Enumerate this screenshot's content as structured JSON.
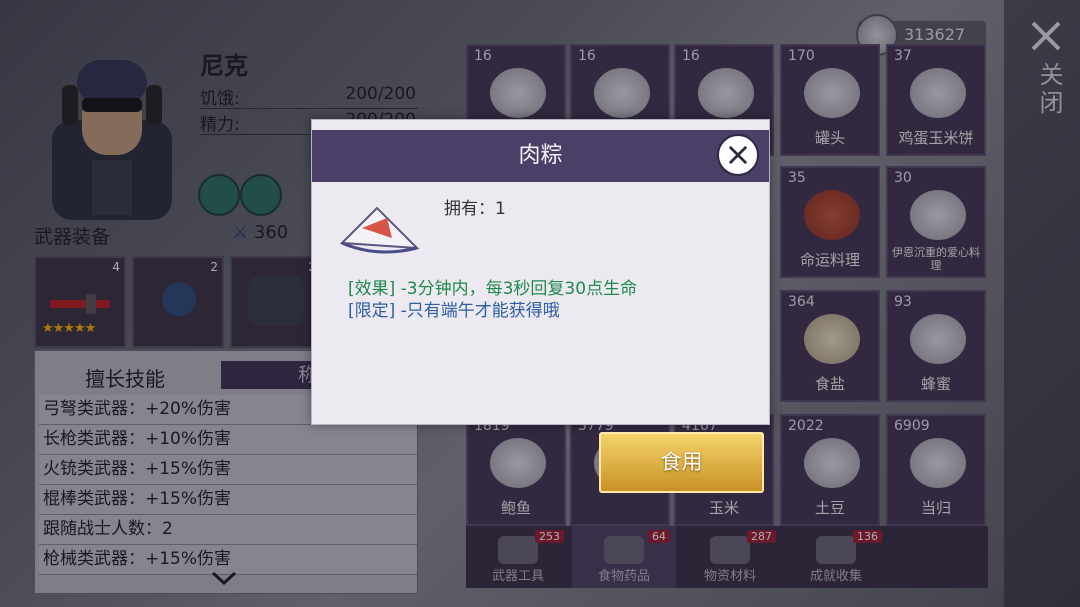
{
  "character": {
    "name": "尼克",
    "hunger_label": "饥饿:",
    "hunger_value": "200/200",
    "energy_label": "精力:",
    "energy_value": "200/200",
    "weapon_section": "武器装备",
    "power": "360",
    "equip_counts": [
      "4",
      "2",
      "2"
    ],
    "star_count": 5
  },
  "skills": {
    "tab_active": "擅长技能",
    "tab_other": "称号",
    "rows": [
      "弓弩类武器：+20%伤害",
      "长枪类武器：+10%伤害",
      "火铳类武器：+15%伤害",
      "棍棒类武器：+15%伤害",
      "跟随战士人数：2",
      "枪械类武器：+15%伤害"
    ]
  },
  "currency": {
    "amount": "313627"
  },
  "close_label": "关闭",
  "items": [
    {
      "qty": "16",
      "name": ""
    },
    {
      "qty": "16",
      "name": ""
    },
    {
      "qty": "16",
      "name": ""
    },
    {
      "qty": "170",
      "name": "罐头"
    },
    {
      "qty": "37",
      "name": "鸡蛋玉米饼"
    },
    {
      "qty": "35",
      "name": "命运料理"
    },
    {
      "qty": "30",
      "name": "伊恩沉重的爱心料理"
    },
    {
      "qty": "364",
      "name": "食盐"
    },
    {
      "qty": "93",
      "name": "蜂蜜"
    },
    {
      "qty": "1819",
      "name": "鲍鱼"
    },
    {
      "qty": "3779",
      "name": ""
    },
    {
      "qty": "4167",
      "name": "玉米"
    },
    {
      "qty": "2022",
      "name": "土豆"
    },
    {
      "qty": "6909",
      "name": "当归"
    }
  ],
  "bottom_tabs": [
    {
      "label": "武器工具",
      "badge": "253"
    },
    {
      "label": "食物药品",
      "badge": "64"
    },
    {
      "label": "物资材料",
      "badge": "287"
    },
    {
      "label": "成就收集",
      "badge": "136"
    }
  ],
  "dialog": {
    "title": "肉粽",
    "own": "拥有：1",
    "effect": "[效果] -3分钟内，每3秒回复30点生命",
    "limit": "[限定] -只有端午才能获得哦"
  },
  "eat_button": "食用",
  "colors": {
    "effect": "#1f8a4c",
    "limit": "#2b5fa6",
    "header": "#4b3f68",
    "button": "#e0b040"
  }
}
